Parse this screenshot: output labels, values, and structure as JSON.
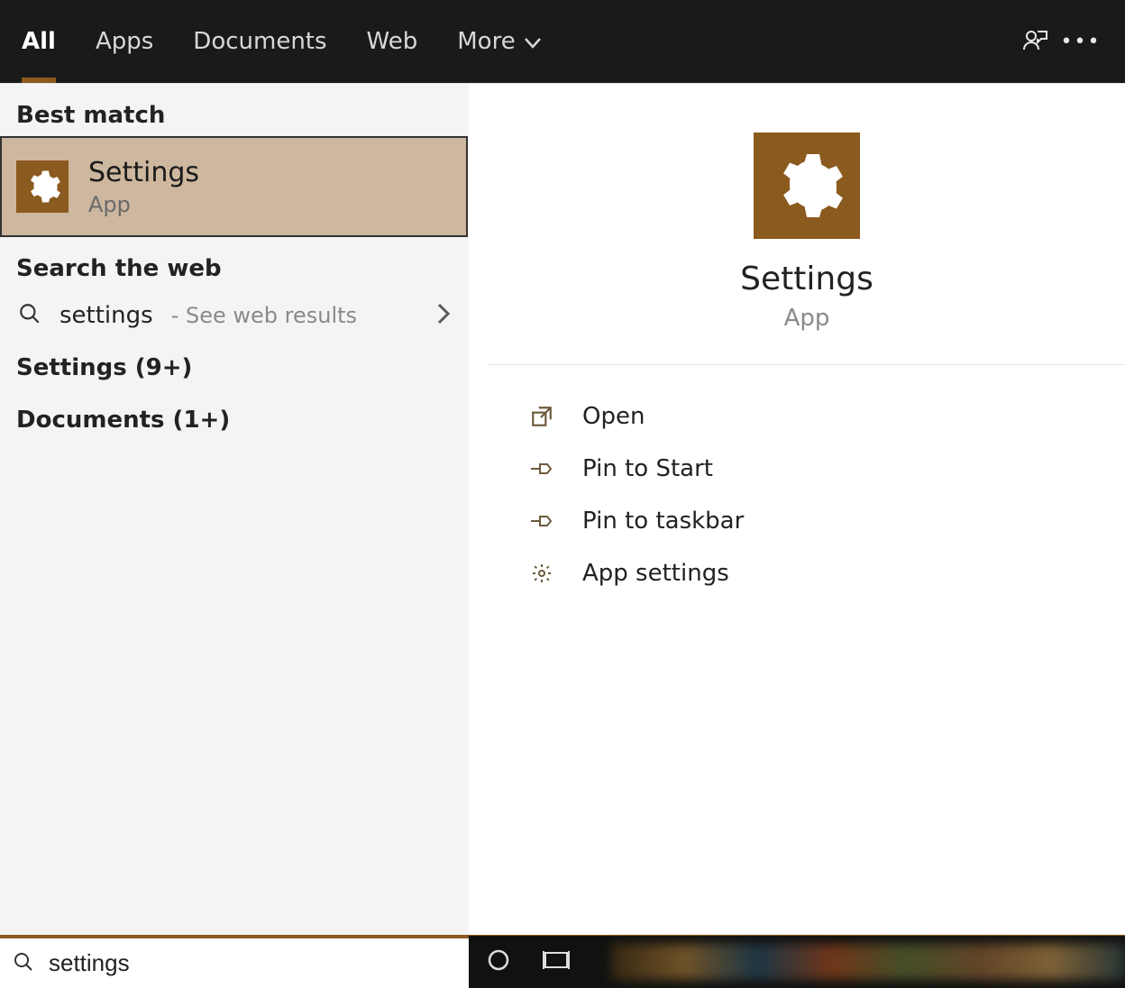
{
  "tabs": {
    "all": "All",
    "apps": "Apps",
    "documents": "Documents",
    "web": "Web",
    "more": "More"
  },
  "left": {
    "best_match_header": "Best match",
    "best_match": {
      "title": "Settings",
      "subtitle": "App"
    },
    "search_web_header": "Search the web",
    "web_term": "settings",
    "web_hint": " - See web results",
    "category_settings": "Settings (9+)",
    "category_documents": "Documents (1+)"
  },
  "detail": {
    "title": "Settings",
    "subtitle": "App",
    "actions": {
      "open": "Open",
      "pin_start": "Pin to Start",
      "pin_taskbar": "Pin to taskbar",
      "app_settings": "App settings"
    }
  },
  "taskbar": {
    "search_value": "settings"
  }
}
